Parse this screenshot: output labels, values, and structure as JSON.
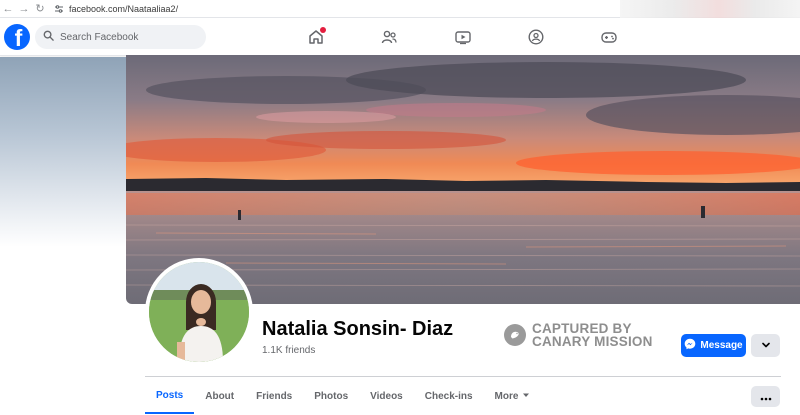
{
  "browser": {
    "url": "facebook.com/Naataaliaa2/"
  },
  "header": {
    "logo_letter": "f",
    "search_placeholder": "Search Facebook",
    "nav_icons": [
      "home-icon",
      "friends-icon",
      "watch-icon",
      "groups-icon",
      "gaming-icon"
    ],
    "home_has_notification": true
  },
  "profile": {
    "name": "Natalia Sonsin- Diaz",
    "friends": "1.1K friends",
    "message_label": "Message"
  },
  "watermark": {
    "line1": "CAPTURED BY",
    "line2": "CANARY MISSION"
  },
  "tabs": [
    {
      "label": "Posts",
      "active": true
    },
    {
      "label": "About",
      "active": false
    },
    {
      "label": "Friends",
      "active": false
    },
    {
      "label": "Photos",
      "active": false
    },
    {
      "label": "Videos",
      "active": false
    },
    {
      "label": "Check-ins",
      "active": false
    },
    {
      "label": "More",
      "active": false
    }
  ],
  "colors": {
    "brand": "#0866ff",
    "notification": "#e41e3f",
    "muted_text": "#65676b"
  }
}
